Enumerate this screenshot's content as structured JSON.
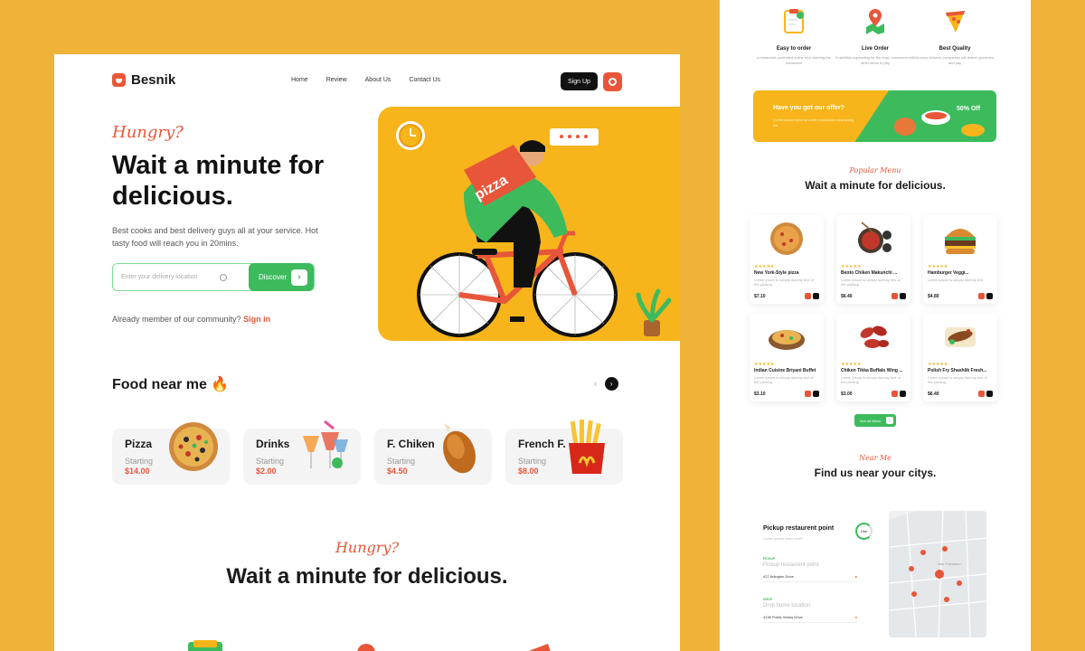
{
  "left_page": {
    "brand": "Besnik",
    "nav": [
      "Home",
      "Review",
      "About Us",
      "Contact Us"
    ],
    "signup_label": "Sign Up",
    "hero": {
      "tagline": "Hungry?",
      "headline": "Wait a minute for delicious.",
      "subtext": "Best cooks and best delivery guys all at your service. Hot tasty food will reach you in 20mins.",
      "location_placeholder": "Enter your delivery location",
      "discover_label": "Discover",
      "already_text": "Already member of our community?",
      "signin_link": "Sign in",
      "illustration_bag_text": "pizza"
    },
    "food_near_me": {
      "title": "Food near me",
      "cards": [
        {
          "name": "Pizza",
          "starting": "Starting",
          "price": "$14.00",
          "icon": "pizza-icon"
        },
        {
          "name": "Drinks",
          "starting": "Starting",
          "price": "$2.00",
          "icon": "cocktail-icon"
        },
        {
          "name": "F. Chiken",
          "starting": "Starting",
          "price": "$4.50",
          "icon": "chicken-leg-icon"
        },
        {
          "name": "French F.",
          "starting": "Starting",
          "price": "$8.00",
          "icon": "fries-icon"
        }
      ]
    },
    "section2": {
      "tagline": "Hungry?",
      "headline": "Wait a minute for delicious."
    }
  },
  "right_page": {
    "features": [
      {
        "title": "Easy to order",
        "desc": "a restaurant-controlled online tool ordering the restaurant",
        "icon": "clipboard-icon"
      },
      {
        "title": "Live Order",
        "desc": "in addition supporting for the food, customers with other items to pay",
        "icon": "map-pin-icon"
      },
      {
        "title": "Best Quality",
        "desc": "Grocery delivery companies will deliver groceries, and pay",
        "icon": "pizza-slice-icon"
      }
    ],
    "offer": {
      "title": "Have you got our offer?",
      "desc": "Lorem ipsum dolor sit amet consectetur adipiscing elit",
      "badge": "50% Off"
    },
    "popular": {
      "tagline": "Popular Menu",
      "headline": "Wait a minute for delicious.",
      "items": [
        {
          "stars": "★★★★★",
          "name": "New York-Style pizza",
          "desc": "Lorem ipsum is simply dummy text of the printing",
          "price": "$7.10"
        },
        {
          "stars": "★★★★★",
          "name": "Bento Chiken Makunchi ...",
          "desc": "Lorem ipsum is simply dummy text of the printing",
          "price": "$6.40"
        },
        {
          "stars": "★★★★★",
          "name": "Hamburger Veggi...",
          "desc": "Lorem ipsum is simply dummy text",
          "price": "$4.80"
        },
        {
          "stars": "★★★★★",
          "name": "Indian Cuisine Briyani Buffet",
          "desc": "Lorem ipsum is simply dummy text of the printing",
          "price": "$3.10"
        },
        {
          "stars": "★★★★★",
          "name": "Chiken Tikka Buffalo Wing ...",
          "desc": "Lorem ipsum is simply dummy text of the printing",
          "price": "$3.00"
        },
        {
          "stars": "★★★★★",
          "name": "Polish Fry Shashlik Fresh...",
          "desc": "Lorem ipsum is simply dummy text of the printing",
          "price": "$6.40"
        }
      ],
      "see_all": "See all Menu"
    },
    "near": {
      "tagline": "Near Me",
      "headline": "Find us near your citys.",
      "pickup_title": "Pickup restaurent point",
      "pickup_sub": "Lorem ipsum dolor amet",
      "timer": "10m",
      "fields": [
        {
          "label": "PICKUP",
          "value": "Pickup restaurent point",
          "address": "427 Arlington Drive"
        },
        {
          "label": "DROP",
          "value": "Drop home location",
          "address": "4136 Public Works Drive"
        }
      ],
      "map_label": "San Francisco"
    }
  },
  "colors": {
    "background": "#EFB33A",
    "accent_orange": "#E8563A",
    "accent_green": "#3DBB5C",
    "hero_yellow": "#F7B51B"
  }
}
